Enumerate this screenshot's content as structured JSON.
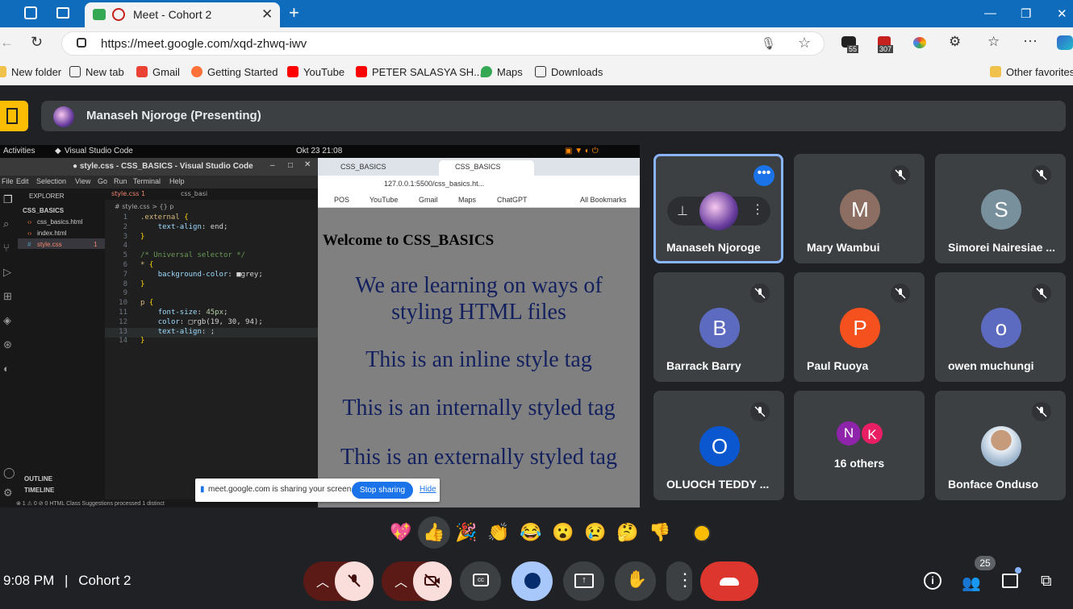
{
  "browser": {
    "tab_title": "Meet - Cohort 2",
    "url": "https://meet.google.com/xqd-zhwq-iwv",
    "ext_badges": [
      "55",
      "307"
    ],
    "bookmarks": [
      "New folder",
      "New tab",
      "Gmail",
      "Getting Started",
      "YouTube",
      "PETER SALASYA SH...",
      "Maps",
      "Downloads"
    ],
    "other_favorites": "Other favorites"
  },
  "meet": {
    "presenter_label": "Manaseh Njoroge (Presenting)",
    "time": "9:08 PM",
    "separator": "|",
    "meeting_name": "Cohort 2",
    "participant_count": "25",
    "participants": [
      {
        "name": "Manaseh Njoroge",
        "initial": "",
        "color": "#3c4043"
      },
      {
        "name": "Mary Wambui",
        "initial": "M",
        "color": "#8d6e63"
      },
      {
        "name": "Simorei Nairesiae ...",
        "initial": "S",
        "color": "#78909c"
      },
      {
        "name": "Barrack Barry",
        "initial": "B",
        "color": "#5c6bc0"
      },
      {
        "name": "Paul Ruoya",
        "initial": "P",
        "color": "#f4511e"
      },
      {
        "name": "owen muchungi",
        "initial": "o",
        "color": "#5c6bc0"
      },
      {
        "name": "OLUOCH TEDDY ...",
        "initial": "O",
        "color": "#0b57d0"
      },
      {
        "name": "16 others",
        "initial_1": "N",
        "initial_2": "K"
      },
      {
        "name": "Bonface Onduso",
        "initial": "",
        "color": "#8d6e63"
      }
    ],
    "reactions": [
      "💖",
      "👍",
      "🎉",
      "👏",
      "😂",
      "😮",
      "😢",
      "🤔",
      "👎"
    ],
    "sharebar": {
      "text": "meet.google.com is sharing your screen.",
      "stop": "Stop sharing",
      "hide": "Hide"
    }
  },
  "shared_screen": {
    "topbar": {
      "activities": "Activities",
      "app": "Visual Studio Code",
      "datetime": "Okt 23  21:08"
    },
    "vscode": {
      "title": "● style.css - CSS_BASICS - Visual Studio Code",
      "menu": [
        "File",
        "Edit",
        "Selection",
        "View",
        "Go",
        "Run",
        "Terminal",
        "Help"
      ],
      "explorer_label": "EXPLORER",
      "folder": "CSS_BASICS",
      "files": [
        "css_basics.html",
        "index.html",
        "style.css"
      ],
      "file_badge": "1",
      "outline": "OUTLINE",
      "timeline": "TIMELINE",
      "tabs": [
        "style.css 1",
        "css_basi"
      ],
      "breadcrumb": "# style.css > {} p",
      "status": "⊗ 1 ⚠ 0   ⊘ 0   HTML Class Suggestions processed 1 distinct",
      "code": [
        {
          "n": "1",
          "t": ".external {"
        },
        {
          "n": "2",
          "t": "    text-align: end;"
        },
        {
          "n": "3",
          "t": "}"
        },
        {
          "n": "4",
          "t": ""
        },
        {
          "n": "5",
          "t": "/* Universal selector */"
        },
        {
          "n": "6",
          "t": "* {"
        },
        {
          "n": "7",
          "t": "    background-color: ■grey;"
        },
        {
          "n": "8",
          "t": "}"
        },
        {
          "n": "9",
          "t": ""
        },
        {
          "n": "10",
          "t": "p {"
        },
        {
          "n": "11",
          "t": "    font-size: 45px;"
        },
        {
          "n": "12",
          "t": "    color: □rgb(19, 30, 94);"
        },
        {
          "n": "13",
          "t": "    text-align: ;"
        },
        {
          "n": "14",
          "t": "}"
        }
      ]
    },
    "chrome": {
      "tabs": [
        "CSS_BASICS",
        "CSS_BASICS"
      ],
      "url": "127.0.0.1:5500/css_basics.ht...",
      "bookmarks": [
        "POS",
        "YouTube",
        "Gmail",
        "Maps",
        "ChatGPT"
      ],
      "all_bookmarks": "All Bookmarks",
      "heading": "Welcome to CSS_BASICS",
      "paragraphs": [
        "We are learning on ways of styling HTML files",
        "This is an inline style tag",
        "This is an internally styled tag",
        "This is an externally styled tag"
      ]
    }
  },
  "colors": {
    "meet_bg": "#202124",
    "tile_bg": "#3c4043",
    "end_call": "#ea4335",
    "accent": "#8ab4f8",
    "leave_yellow": "#fbbc04"
  }
}
